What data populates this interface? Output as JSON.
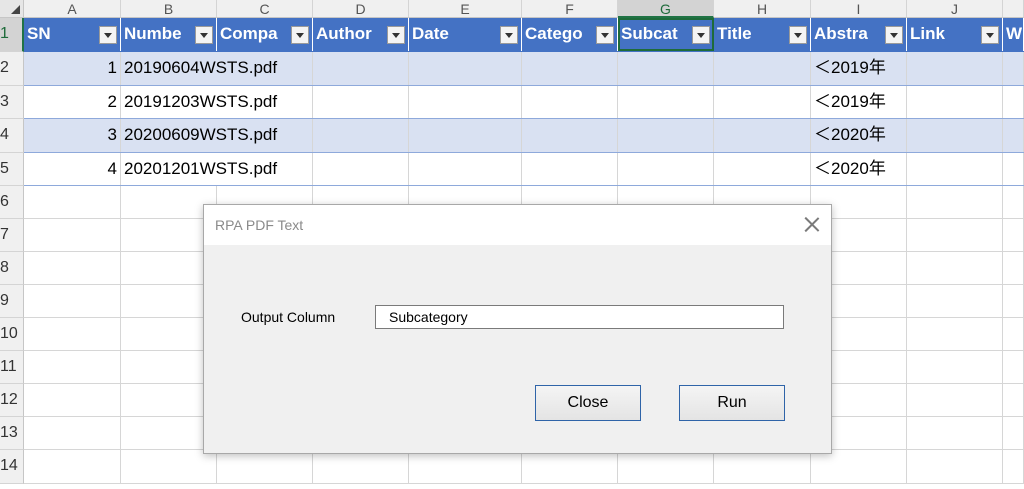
{
  "sheet": {
    "columns": [
      "A",
      "B",
      "C",
      "D",
      "E",
      "F",
      "G",
      "H",
      "I",
      "J"
    ],
    "selected_column": "G",
    "rows": [
      "1",
      "2",
      "3",
      "4",
      "5",
      "6",
      "7",
      "8",
      "9",
      "10",
      "11",
      "12",
      "13",
      "14"
    ],
    "headers": [
      "SN",
      "Numbe",
      "Compa",
      "Author",
      "Date",
      "Catego",
      "Subcat",
      "Title",
      "Abstra",
      "Link",
      "W"
    ],
    "data": [
      {
        "sn": "1",
        "number": "20190604WSTS.pdf",
        "abstract": "＜2019年"
      },
      {
        "sn": "2",
        "number": "20191203WSTS.pdf",
        "abstract": "＜2019年"
      },
      {
        "sn": "3",
        "number": "20200609WSTS.pdf",
        "abstract": "＜2020年"
      },
      {
        "sn": "4",
        "number": "20201201WSTS.pdf",
        "abstract": "＜2020年"
      }
    ],
    "colors": {
      "header": "#4472c4",
      "band": "#d9e1f2",
      "selection": "#217346"
    }
  },
  "dialog": {
    "title": "RPA PDF Text",
    "output_label": "Output Column",
    "output_value": "Subcategory",
    "close_label": "Close",
    "run_label": "Run"
  }
}
